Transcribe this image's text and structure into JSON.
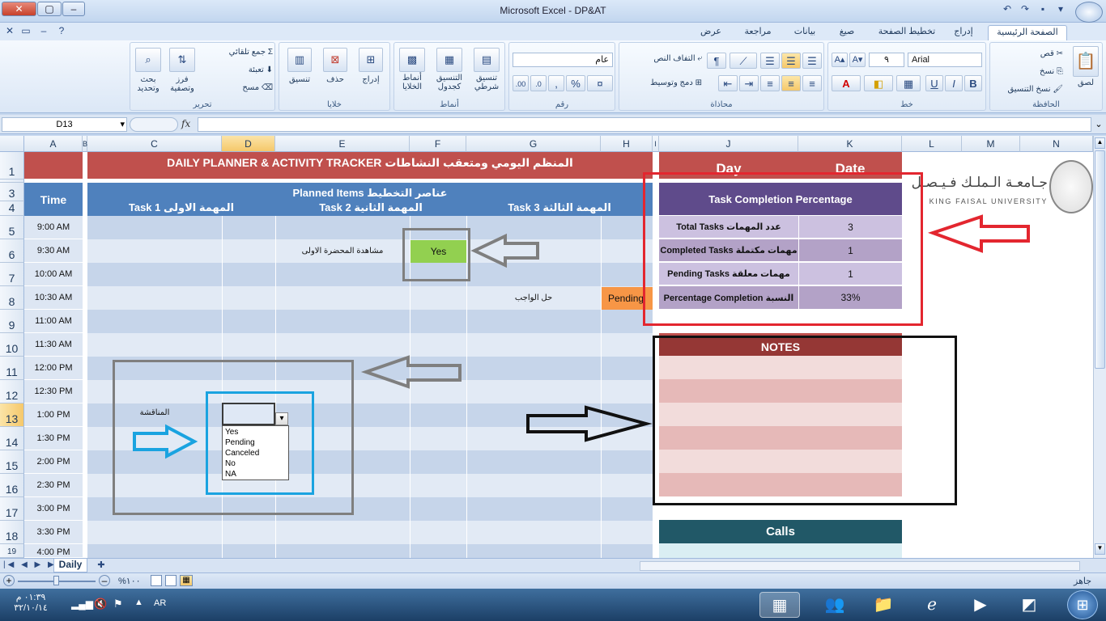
{
  "window": {
    "title": "Microsoft Excel - DP&AT",
    "close_glyph": "✕",
    "max_glyph": "▢",
    "min_glyph": "–"
  },
  "ribbon_tabs": [
    "الصفحة الرئيسية",
    "إدراج",
    "تخطيط الصفحة",
    "صيغ",
    "بيانات",
    "مراجعة",
    "عرض"
  ],
  "ribbon": {
    "clipboard": {
      "label": "الحافظة",
      "paste": "لصق",
      "cut": "قص",
      "copy": "نسخ",
      "format_painter": "نسخ التنسيق"
    },
    "font": {
      "label": "خط",
      "font_name": "Arial",
      "font_size": "٩",
      "bold": "B",
      "italic": "I",
      "underline": "U"
    },
    "alignment": {
      "label": "محاذاة",
      "wrap_text": "التفاف النص",
      "merge_center": "دمج وتوسيط"
    },
    "number": {
      "label": "رقم",
      "format": "عام",
      "percent": "%",
      "comma": ","
    },
    "styles": {
      "label": "أنماط",
      "conditional": "تنسيق شرطي",
      "as_table": "التنسيق كجدول",
      "cell_styles": "أنماط الخلايا"
    },
    "cells": {
      "label": "خلايا",
      "insert": "إدراج",
      "delete": "حذف",
      "format": "تنسيق"
    },
    "editing": {
      "label": "تحرير",
      "autosum": "جمع تلقائي",
      "fill": "تعبئة",
      "clear": "مسح",
      "sort_filter": "فرز وتصفية",
      "find_select": "بحث وتحديد"
    }
  },
  "formula_bar": {
    "name_box": "D13",
    "fx": "fx",
    "formula": ""
  },
  "columns": [
    "A",
    "B",
    "C",
    "D",
    "E",
    "F",
    "G",
    "H",
    "I",
    "J",
    "K",
    "L",
    "M",
    "N"
  ],
  "rows": [
    "1",
    "2",
    "3",
    "4",
    "5",
    "6",
    "7",
    "8",
    "9",
    "10",
    "11",
    "12",
    "13",
    "14",
    "15",
    "16",
    "17",
    "18",
    "19"
  ],
  "planner": {
    "title": "DAILY PLANNER & ACTIVITY TRACKER المنظم اليومي ومتعقب النشاطات",
    "time_header": "Time",
    "planned_items": "Planned Items عناصر التخطيط",
    "task1": "Task 1 المهمة الاولى",
    "task2": "Task 2 المهمة الثانية",
    "task3": "Task 3 المهمة الثالثة",
    "times": [
      "9:00 AM",
      "9:30 AM",
      "10:00 AM",
      "10:30 AM",
      "11:00 AM",
      "11:30 AM",
      "12:00 PM",
      "12:30 PM",
      "1:00 PM",
      "1:30 PM",
      "2:00 PM",
      "2:30 PM",
      "3:00 PM",
      "3:30 PM",
      "4:00 PM"
    ],
    "row6_task": "مشاهدة المحضرة الاولى",
    "row6_status": "Yes",
    "row8_task": "حل الواجب",
    "row8_status": "Pending",
    "row13_task": "المناقشة",
    "dropdown_options": [
      "Yes",
      "Pending",
      "Canceled",
      "No",
      "NA"
    ]
  },
  "right_panel": {
    "day": "Day",
    "date": "Date",
    "completion_title": "Task Completion Percentage",
    "total_label": "Total Tasks عدد المهمات",
    "total_value": "3",
    "completed_label": "Completed Tasks مهمات مكتملة",
    "completed_value": "1",
    "pending_label": "Pending Tasks مهمات معلقة",
    "pending_value": "1",
    "percent_label": "Percentage Completion النسبة",
    "percent_value": "33%",
    "notes_title": "NOTES",
    "calls_title": "Calls"
  },
  "logo": {
    "arabic": "جـامعـة الـملـك فـيـصـل",
    "english": "KING FAISAL UNIVERSITY"
  },
  "sheet_tabs": {
    "active": "Daily"
  },
  "status": {
    "ready": "جاهز",
    "zoom": "%١٠٠"
  },
  "taskbar": {
    "lang": "AR",
    "time": "٠١:٣٩ م",
    "date": "٣٢/١٠/١٤"
  },
  "colors": {
    "title_red": "#c0504d",
    "header_blue": "#4f81bd",
    "yes_green": "#92d050",
    "pending_orange": "#f79646",
    "summary_purple": "#5f4b8b",
    "notes_red": "#953735",
    "calls_teal": "#215867"
  }
}
